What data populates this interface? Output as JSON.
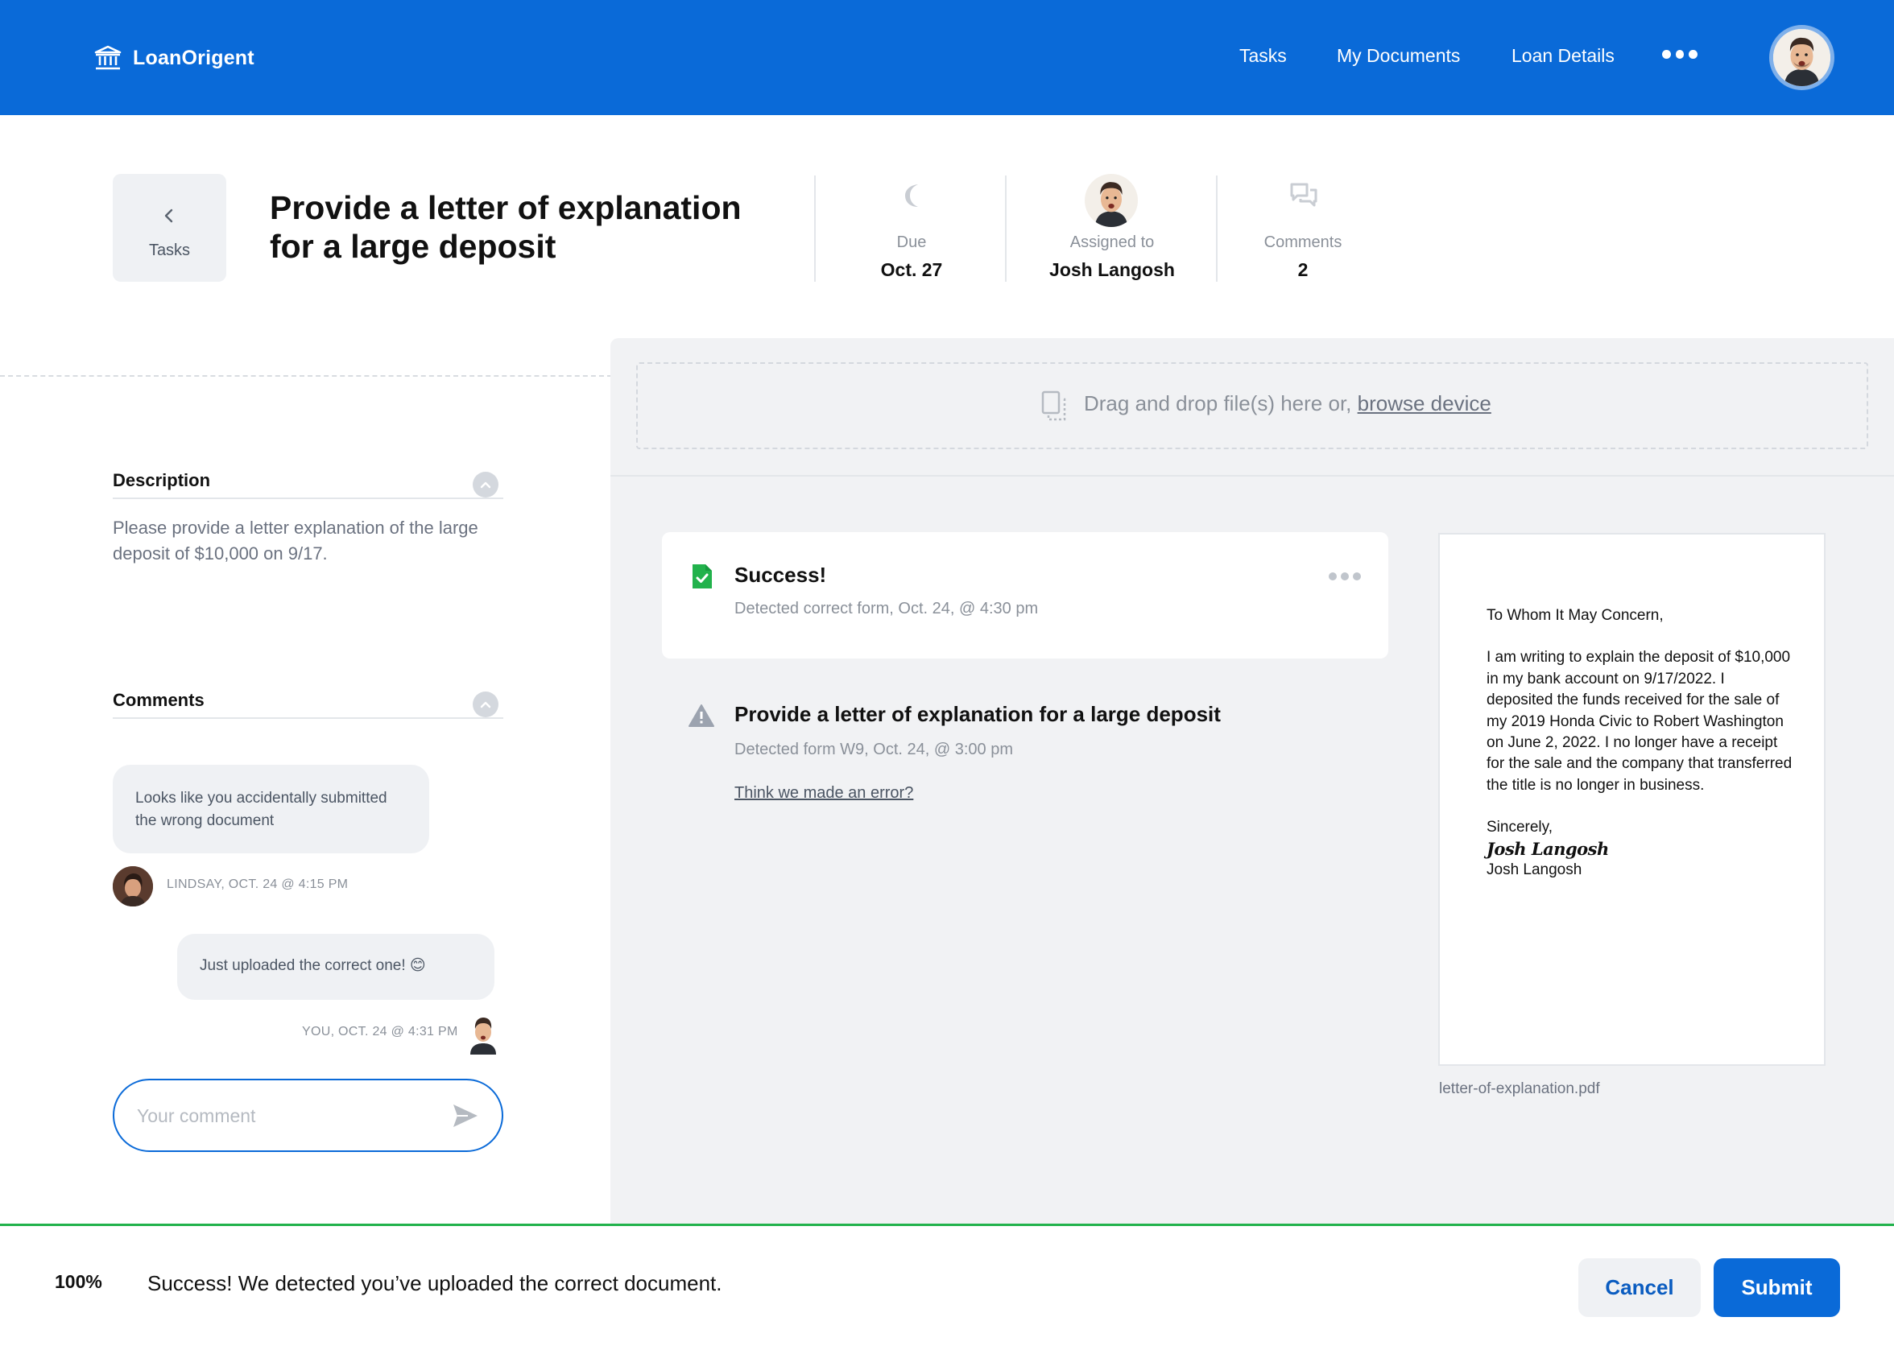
{
  "app": {
    "name": "LoanOrigent"
  },
  "nav": {
    "items": [
      {
        "label": "Tasks"
      },
      {
        "label": "My Documents"
      },
      {
        "label": "Loan Details"
      }
    ]
  },
  "task": {
    "back_label": "Tasks",
    "title": "Provide a letter of explanation for a large deposit",
    "due_label": "Due",
    "due_value": "Oct. 27",
    "assigned_label": "Assigned to",
    "assigned_value": "Josh Langosh",
    "comments_label": "Comments",
    "comments_value": "2"
  },
  "description": {
    "heading": "Description",
    "text": "Please provide a letter explanation of the large deposit of $10,000 on 9/17."
  },
  "comments": {
    "heading": "Comments",
    "items": [
      {
        "text": "Looks like you accidentally submitted the wrong document",
        "meta": "LINDSAY, OCT. 24 @ 4:15 PM"
      },
      {
        "text": "Just uploaded the correct one! 😊",
        "meta": "YOU, OCT. 24 @ 4:31 PM"
      }
    ],
    "placeholder": "Your comment"
  },
  "upload": {
    "prompt": "Drag and drop file(s) here or,",
    "browse_link": "browse device"
  },
  "results": {
    "success": {
      "title": "Success!",
      "detail": "Detected correct form, Oct. 24, @ 4:30 pm"
    },
    "error": {
      "title": "Provide a letter of explanation for a large deposit",
      "detail": "Detected form W9, Oct. 24, @ 3:00 pm",
      "link": "Think we made an error?"
    }
  },
  "document": {
    "greeting": "To Whom It May Concern,",
    "body": "I am writing to explain the deposit of $10,000 in my bank account on 9/17/2022. I deposited the funds received for the sale of my 2019 Honda Civic to Robert Washington on June 2, 2022. I no longer have a receipt for the sale and the company that transferred the title is no longer in business.",
    "closing": "Sincerely,",
    "signature": "Josh Langosh",
    "name": "Josh Langosh",
    "filename": "letter-of-explanation.pdf"
  },
  "footer": {
    "progress": "100%",
    "message": "Success! We detected you’ve uploaded the correct document.",
    "cancel_label": "Cancel",
    "submit_label": "Submit"
  },
  "colors": {
    "brand": "#0a6ad8",
    "success": "#22b24c",
    "warning": "#9ca3af"
  },
  "icons": {
    "logo": "bank-icon",
    "menu": "more-icon",
    "back": "chevron-left-icon",
    "due": "moon-icon",
    "comments": "chat-icon",
    "upload": "file-icon",
    "success": "file-check-icon",
    "warning": "warning-icon",
    "send": "send-icon"
  }
}
